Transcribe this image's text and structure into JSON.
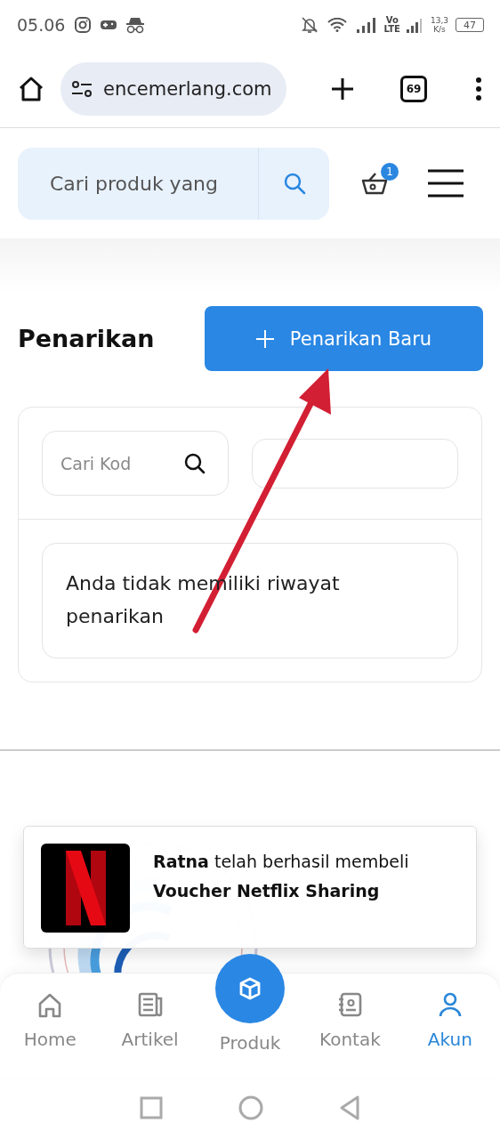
{
  "status_bar": {
    "time": "05.06",
    "network": [
      "Vo",
      "LTE"
    ],
    "speed": [
      "13,3",
      "K/s"
    ],
    "battery": "47"
  },
  "browser": {
    "url": "encemerlang.com",
    "tab_count": "69"
  },
  "header": {
    "search": {
      "placeholder": "Cari produk yang"
    },
    "cart_count": "1"
  },
  "page": {
    "title": "Penarikan",
    "new_button": "Penarikan Baru"
  },
  "filters": {
    "search": {
      "placeholder": "Cari Kod"
    }
  },
  "empty_message": "Anda tidak memiliki riwayat penarikan",
  "toast": {
    "message": "**Ratna** telah berhasil membeli",
    "product": "Voucher Netflix Sharing"
  },
  "bottom_nav": [
    {
      "label": "Home",
      "kind": "tab",
      "selected": false
    },
    {
      "label": "Artikel",
      "kind": "tab",
      "selected": false
    },
    {
      "label": "Produk",
      "kind": "fab",
      "selected": false
    },
    {
      "label": "Kontak",
      "kind": "tab",
      "selected": false
    },
    {
      "label": "Akun",
      "kind": "tab",
      "selected": true
    }
  ]
}
